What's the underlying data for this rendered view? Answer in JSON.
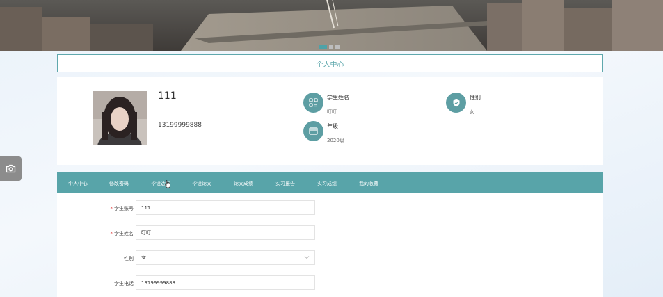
{
  "banner": {
    "slides": 3,
    "active_slide": 1
  },
  "page_title": "个人中心",
  "profile": {
    "username": "111",
    "phone": "13199999888",
    "fields": [
      {
        "icon": "grid-icon",
        "label": "学生姓名",
        "value": "叮叮"
      },
      {
        "icon": "shield-icon",
        "label": "性别",
        "value": "女"
      },
      {
        "icon": "card-icon",
        "label": "年级",
        "value": "2020级"
      }
    ]
  },
  "tabs": [
    "个人中心",
    "修改密码",
    "毕设选题",
    "毕设论文",
    "论文成绩",
    "实习报告",
    "实习成绩",
    "我的收藏"
  ],
  "form": {
    "account_label": "学生账号",
    "account_value": "111",
    "name_label": "学生姓名",
    "name_value": "叮叮",
    "gender_label": "性别",
    "gender_value": "女",
    "phone_label": "学生电话",
    "phone_value": "13199999888",
    "required_mark": "*"
  },
  "colors": {
    "accent": "#58a4a9",
    "icon_bg": "#5d9ea3",
    "required": "#e24b4b"
  }
}
